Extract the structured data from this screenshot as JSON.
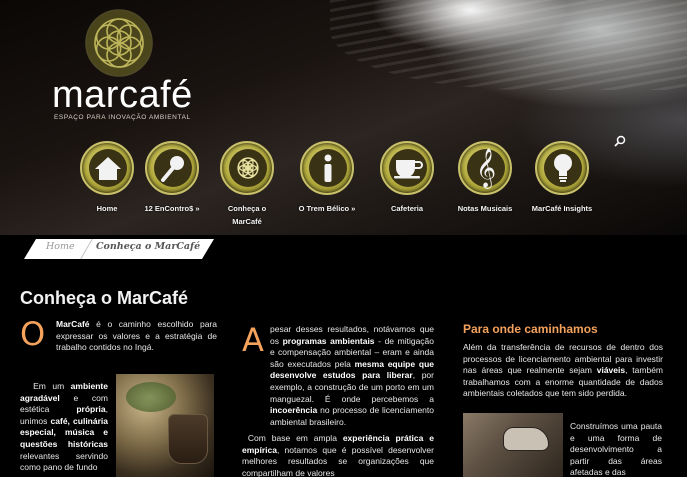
{
  "colors": {
    "accent": "#f5a25d",
    "nav_olive": "#b3ab3c",
    "background": "#000000"
  },
  "logo": {
    "brand_left": "mar",
    "brand_right": "café",
    "tagline": "ESPAÇO PARA INOVAÇÃO AMBIENTAL"
  },
  "nav": {
    "items": [
      {
        "label": "Home",
        "icon": "house-icon"
      },
      {
        "label": "12 EnContro$ »",
        "icon": "microphone-icon"
      },
      {
        "label": "Conheça o MarCafé",
        "icon": "flower-of-life-icon"
      },
      {
        "label": "O Trem Bélico »",
        "icon": "info-icon"
      },
      {
        "label": "Cafeteria",
        "icon": "coffee-cup-icon"
      },
      {
        "label": "Notas Musicais",
        "icon": "treble-clef-icon"
      },
      {
        "label": "MarCafé Insights",
        "icon": "lightbulb-icon"
      }
    ]
  },
  "breadcrumb": {
    "home": "Home",
    "current": "Conheça o MarCafé"
  },
  "page": {
    "title": "Conheça o MarCafé",
    "col1": {
      "dropcap": "O",
      "intro_bold": "MarCafé",
      "intro": " é o caminho escolhido para expressar os valores e a estratégia de trabalho contidos no Ingá.",
      "body_1": "Em um ",
      "body_1b": "ambiente agradável",
      "body_2": " e com estética ",
      "body_2b": "própria",
      "body_3": ", unimos ",
      "body_3b": "café, culinária especial, música e questões históricas",
      "body_4": " relevantes servindo como pano de fundo"
    },
    "col2": {
      "dropcap": "A",
      "text_1": "pesar desses resultados, notávamos que os ",
      "text_1b": "programas ambientais",
      "text_2": " - de mitigação e compensação ambiental – eram e ainda são executados pela ",
      "text_2b": "mesma equipe que desenvolve estudos para liberar",
      "text_3": ", por exemplo, a construção de um porto em um manguezal. É onde percebemos a ",
      "text_3b": "incoerência",
      "text_4": " no processo de licenciamento ambiental brasileiro.",
      "para2_1": "Com base em ampla ",
      "para2_1b": "experiência prática e empírica",
      "para2_2": ", notamos que é possível desenvolver melhores resultados se organizações que compartilham de valores"
    },
    "col3": {
      "heading": "Para onde caminhamos",
      "text_1": "Além da transferência de recursos de dentro dos processos de licenciamento ambiental para investir nas áreas que realmente sejam ",
      "text_1b": "viáveis",
      "text_2": ", também trabalhamos com a enorme quantidade de dados ambientais coletados que tem sido perdida.",
      "text_3": "Construímos uma pauta e uma forma de desenvolvimento a partir das áreas afetadas e das"
    }
  }
}
